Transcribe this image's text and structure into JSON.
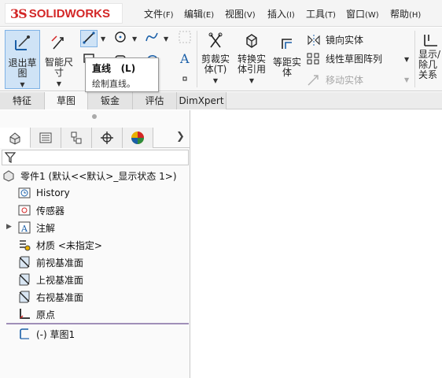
{
  "app": {
    "logo_ds": "3S",
    "logo_text": "SOLIDWORKS"
  },
  "menu": [
    {
      "label": "文件",
      "hotkey": "(F)"
    },
    {
      "label": "编辑",
      "hotkey": "(E)"
    },
    {
      "label": "视图",
      "hotkey": "(V)"
    },
    {
      "label": "插入",
      "hotkey": "(I)"
    },
    {
      "label": "工具",
      "hotkey": "(T)"
    },
    {
      "label": "窗口",
      "hotkey": "(W)"
    },
    {
      "label": "帮助",
      "hotkey": "(H)"
    }
  ],
  "ribbon": {
    "exit_sketch": "退出草\n图",
    "smart_dimension": "智能尺\n寸",
    "trim": "剪裁实\n体(T)",
    "convert": "转换实\n体引用",
    "offset": "等距实\n体",
    "mirror": "镜向实体",
    "linear_pattern": "线性草图阵列",
    "move": "移动实体",
    "display_delete": "显示/\n除几\n关系"
  },
  "tooltip": {
    "title": "直线",
    "hotkey": "(L)",
    "desc": "绘制直线。"
  },
  "tabs": [
    "特征",
    "草图",
    "钣金",
    "评估",
    "DimXpert"
  ],
  "active_tab": "草图",
  "tree": {
    "root": {
      "label": "零件1",
      "config": "(默认<<默认>_显示状态 1>)"
    },
    "items": [
      {
        "label": "History",
        "icon": "history-icon"
      },
      {
        "label": "传感器",
        "icon": "sensor-icon"
      },
      {
        "label": "注解",
        "icon": "annotation-icon"
      },
      {
        "label": "材质 <未指定>",
        "icon": "material-icon"
      },
      {
        "label": "前视基准面",
        "icon": "plane-icon"
      },
      {
        "label": "上视基准面",
        "icon": "plane-icon"
      },
      {
        "label": "右视基准面",
        "icon": "plane-icon"
      },
      {
        "label": "原点",
        "icon": "origin-icon"
      },
      {
        "label": "(-) 草图1",
        "icon": "sketch-icon"
      }
    ]
  },
  "colors": {
    "accent": "#d32626",
    "active_tool": "#cfe3f6",
    "tree_divider": "#a08fb8"
  }
}
